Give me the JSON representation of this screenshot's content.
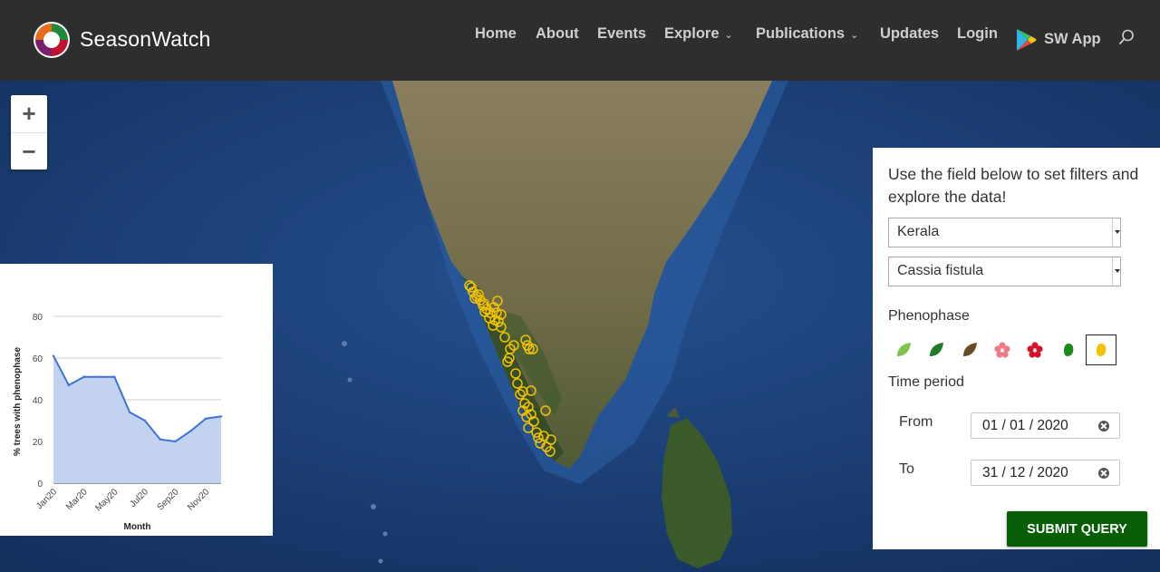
{
  "header": {
    "brand": "SeasonWatch",
    "nav": [
      {
        "label": "Home",
        "dropdown": false
      },
      {
        "label": "About",
        "dropdown": false
      },
      {
        "label": "Events",
        "dropdown": false
      },
      {
        "label": "Explore",
        "dropdown": true
      },
      {
        "label": "Publications",
        "dropdown": true
      },
      {
        "label": "Updates",
        "dropdown": false
      },
      {
        "label": "Login",
        "dropdown": false
      }
    ],
    "app_label": "SW App",
    "icons": {
      "logo": "seasonwatch-logo",
      "app": "google-play-icon",
      "search": "search-icon"
    }
  },
  "map": {
    "zoom_in": "+",
    "zoom_out": "−",
    "marker_color": "#f2c200"
  },
  "filters": {
    "intro": "Use the field below to set filters and explore the data!",
    "region": "Kerala",
    "species": "Cassia fistula",
    "phenophase_label": "Phenophase",
    "phenophases": [
      {
        "name": "leaf-light-green-icon",
        "color": "#7cc24b"
      },
      {
        "name": "leaf-dark-green-icon",
        "color": "#1f7a2c"
      },
      {
        "name": "leaf-brown-icon",
        "color": "#6b4a24"
      },
      {
        "name": "flower-pink-icon",
        "color": "#f07a8a"
      },
      {
        "name": "flower-red-icon",
        "color": "#d4142a"
      },
      {
        "name": "fruit-green-icon",
        "color": "#1e8a1e"
      },
      {
        "name": "fruit-yellow-icon",
        "color": "#f3c200"
      }
    ],
    "selected_phenophase": 6,
    "time_label": "Time period",
    "from_label": "From",
    "from_value": "01 / 01 / 2020",
    "to_label": "To",
    "to_value": "31 / 12 / 2020",
    "submit_label": "SUBMIT QUERY"
  },
  "chart_data": {
    "type": "area",
    "x": [
      "Jan20",
      "Feb20",
      "Mar20",
      "Apr20",
      "May20",
      "Jun20",
      "Jul20",
      "Aug20",
      "Sep20",
      "Oct20",
      "Nov20",
      "Dec20"
    ],
    "xtick_labels": [
      "Jan20",
      "Mar20",
      "May20",
      "Jul20",
      "Sep20",
      "Nov20"
    ],
    "values": [
      61,
      47,
      51,
      51,
      51,
      34,
      30,
      21,
      20,
      25,
      31,
      32
    ],
    "ylim": [
      0,
      80
    ],
    "yticks": [
      0,
      20,
      40,
      60,
      80
    ],
    "xlabel": "Month",
    "ylabel": "% trees with phenophase",
    "grid": true,
    "line_color": "#3d72d9",
    "fill_color": "#c3d3ef"
  }
}
